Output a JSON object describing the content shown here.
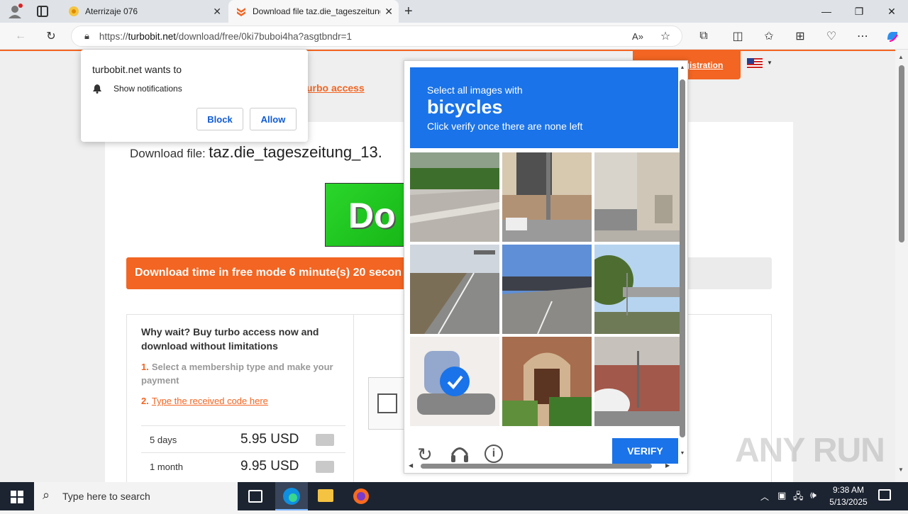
{
  "browser": {
    "tabs": [
      {
        "title": "Aterrizaje 076"
      },
      {
        "title": "Download file taz.die_tageszeitung"
      }
    ],
    "url_prefix": "https://",
    "url_domain": "turbobit.net",
    "url_path": "/download/free/0ki7buboi4ha?asgtbndr=1"
  },
  "notification": {
    "title": "turbobit.net wants to",
    "item": "Show notifications",
    "block_label": "Block",
    "allow_label": "Allow"
  },
  "page": {
    "turbo_link": "urbo access",
    "registration_link": "egistration",
    "download_label": "Download file:",
    "file_name": "taz.die_tageszeitung_13.",
    "banner_text": "Do",
    "free_mode_text": "Download time in free mode 6 minute(s) 20 secon",
    "why_wait": "Why wait? Buy turbo access now and download without limitations",
    "step1_num": "1.",
    "step1_text": "Select a membership type and make your payment",
    "step2_num": "2.",
    "step2_text": "Type the received code here",
    "plans": [
      {
        "period": "5 days",
        "price": "5.95 USD"
      },
      {
        "period": "1 month",
        "price": "9.95 USD"
      }
    ]
  },
  "captcha": {
    "instruction": "Select all images with",
    "target": "bicycles",
    "subtext": "Click verify once there are none left",
    "verify_label": "VERIFY",
    "selected_tile_index": 6
  },
  "taskbar": {
    "search_placeholder": "Type here to search",
    "time": "9:38 AM",
    "date": "5/13/2025"
  },
  "watermark": "ANY RUN",
  "colors": {
    "accent_orange": "#f26522",
    "captcha_blue": "#1a73e8",
    "taskbar": "#1c2431"
  }
}
